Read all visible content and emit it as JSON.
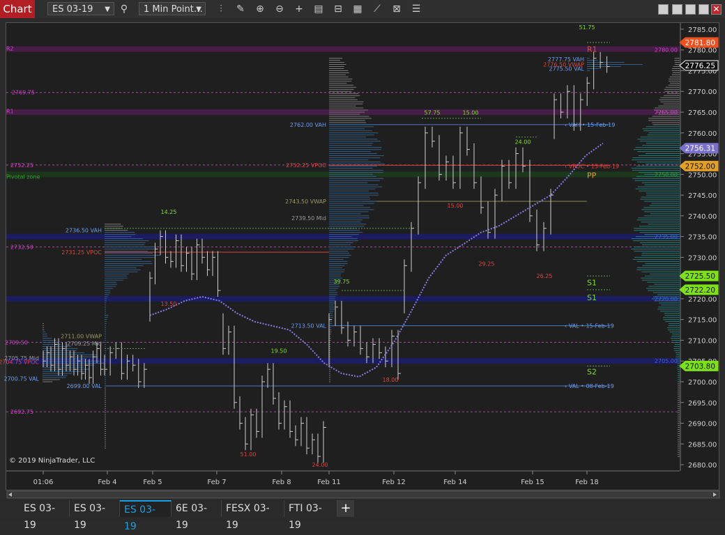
{
  "title_tab": "Chart",
  "toolbar": {
    "instrument": "ES 03-19",
    "interval": "1 Min Point…"
  },
  "colors": {
    "bg": "#1f1f1f",
    "accent": "#b11e23",
    "vwap": "#8a7fe6",
    "poc": "#e2423f",
    "vah": "#6a9ef2",
    "pivot": "#d040c8"
  },
  "copyright": "© 2019 NinjaTrader, LLC",
  "tabs": [
    "ES 03-19",
    "ES 03-19",
    "ES 03-19",
    "6E 03-19",
    "FESX 03-19",
    "FTI 03-19"
  ],
  "active_tab_index": 2,
  "chart_data": {
    "type": "line",
    "yaxis_labels": [
      "2785.00",
      "2780.00",
      "2775.00",
      "2770.00",
      "2765.00",
      "2760.00",
      "2755.00",
      "2750.00",
      "2745.00",
      "2740.00",
      "2735.00",
      "2730.00",
      "2725.00",
      "2720.00",
      "2715.00",
      "2710.00",
      "2705.00",
      "2700.00",
      "2695.00",
      "2690.00",
      "2685.00",
      "2680.00"
    ],
    "ylim": [
      2678.5,
      2786.5
    ],
    "xaxis_labels": [
      "01:06",
      "Feb 4",
      "Feb 5",
      "Feb 7",
      "Feb 8",
      "Feb 11",
      "Feb 12",
      "Feb 14",
      "Feb 15",
      "Feb 18"
    ],
    "price_tags": [
      {
        "value": "2781.80",
        "color": "#f0501e",
        "text": "#fff"
      },
      {
        "value": "2776.25",
        "color": "#111",
        "text": "#fff"
      },
      {
        "value": "2756.31",
        "color": "#7a70c8",
        "text": "#fff"
      },
      {
        "value": "2752.00",
        "color": "#e2a028",
        "text": "#111"
      },
      {
        "value": "2725.50",
        "color": "#7de01a",
        "text": "#111"
      },
      {
        "value": "2722.20",
        "color": "#7de01a",
        "text": "#111"
      },
      {
        "value": "2703.80",
        "color": "#7de01a",
        "text": "#111"
      }
    ],
    "pivot_labels": [
      {
        "text": "R2",
        "price": 2780.5,
        "color": "#d040c8"
      },
      {
        "text": "R1",
        "price": 2765.4,
        "color": "#d040c8"
      },
      {
        "text": "Pivotal zone",
        "price": 2749.6,
        "color": "#2fa02f"
      },
      {
        "text": "R1",
        "price": 2780.2,
        "color": "#f0501e"
      },
      {
        "text": "PP",
        "price": 2749.8,
        "color": "#e2a028"
      },
      {
        "text": "S1",
        "price": 2723.9,
        "color": "#7de01a"
      },
      {
        "text": "S1",
        "price": 2720.3,
        "color": "#7de01a"
      },
      {
        "text": "S2",
        "price": 2702.4,
        "color": "#7de01a"
      }
    ],
    "level_labels": [
      {
        "text": "2769.75",
        "price": 2769.75,
        "color": "#d040c8"
      },
      {
        "text": "2752.25",
        "price": 2752.25,
        "color": "#d040c8"
      },
      {
        "text": "2732.50",
        "price": 2732.5,
        "color": "#d040c8"
      },
      {
        "text": "2692.75",
        "price": 2692.75,
        "color": "#d040c8"
      },
      {
        "text": "2762.00 VAH",
        "price": 2762.0,
        "color": "#6a9ef2"
      },
      {
        "text": "2752.25 VPOC",
        "price": 2752.25,
        "color": "#e2423f"
      },
      {
        "text": "2743.50 VWAP",
        "price": 2743.5,
        "color": "#9a9a60"
      },
      {
        "text": "2739.50 Mid",
        "price": 2739.5,
        "color": "#9a9a9a"
      },
      {
        "text": "2736.50 VAH",
        "price": 2736.5,
        "color": "#6a9ef2"
      },
      {
        "text": "2731.25 VPOC",
        "price": 2731.25,
        "color": "#e2423f"
      },
      {
        "text": "2713.50 VAL",
        "price": 2713.5,
        "color": "#6a9ef2"
      },
      {
        "text": "2699.00 VAL",
        "price": 2699.0,
        "color": "#6a9ef2"
      },
      {
        "text": "2700.75 VAL",
        "price": 2700.75,
        "color": "#6a9ef2"
      },
      {
        "text": "2704.75 VPOC",
        "price": 2704.75,
        "color": "#e2423f"
      },
      {
        "text": "2709.50",
        "price": 2709.5,
        "color": "#d040c8"
      },
      {
        "text": "2711.00 VWAP",
        "price": 2711.0,
        "color": "#9a9a60"
      },
      {
        "text": "2709.25 Mid",
        "price": 2709.25,
        "color": "#9a9a9a"
      },
      {
        "text": "2705.75 Mid",
        "price": 2705.75,
        "color": "#9a9a9a"
      },
      {
        "text": "2777.75 VAH",
        "price": 2777.75,
        "color": "#6a9ef2"
      },
      {
        "text": "2776.50 VWAP",
        "price": 2776.5,
        "color": "#e2423f"
      },
      {
        "text": "2775.50 VAL",
        "price": 2775.5,
        "color": "#6a9ef2"
      },
      {
        "text": "2780.00",
        "price": 2780.0,
        "color": "#d040c8"
      },
      {
        "text": "2765.00",
        "price": 2765.0,
        "color": "#d040c8"
      },
      {
        "text": "2750.00",
        "price": 2750.0,
        "color": "#2fa02f"
      },
      {
        "text": "2735.00",
        "price": 2735.0,
        "color": "#4060e0"
      },
      {
        "text": "2720.00",
        "price": 2720.0,
        "color": "#4060e0"
      },
      {
        "text": "2705.00",
        "price": 2705.0,
        "color": "#4060e0"
      }
    ],
    "right_annotations": [
      {
        "text": "VAH • 15-Feb-19",
        "price": 2762.0,
        "color": "#6a9ef2"
      },
      {
        "text": "VPOC • 15-Feb-19",
        "price": 2752.0,
        "color": "#e2423f"
      },
      {
        "text": "VAL • 15-Feb-19",
        "price": 2713.5,
        "color": "#6a9ef2"
      },
      {
        "text": "VAL • 08-Feb-19",
        "price": 2699.0,
        "color": "#6a9ef2"
      }
    ],
    "swing_labels": [
      {
        "text": "14.25",
        "price": 2740.5,
        "day": "Feb 5",
        "color": "#7de01a"
      },
      {
        "text": "13.50",
        "price": 2718.3,
        "day": "Feb 5",
        "color": "#e2423f"
      },
      {
        "text": "19.50",
        "price": 2707.0,
        "day": "Feb 8",
        "color": "#7de01a"
      },
      {
        "text": "51.00",
        "price": 2682.0,
        "day": "Feb 7",
        "color": "#e2423f"
      },
      {
        "text": "24.00",
        "price": 2679.5,
        "day": "Feb 8",
        "color": "#e2423f"
      },
      {
        "text": "39.75",
        "price": 2723.7,
        "day": "Feb 11",
        "color": "#7de01a"
      },
      {
        "text": "18.00",
        "price": 2700.0,
        "day": "Feb 12",
        "color": "#e2423f"
      },
      {
        "text": "57.75",
        "price": 2764.4,
        "day": "Feb 12",
        "color": "#7de01a"
      },
      {
        "text": "15.00",
        "price": 2764.4,
        "day": "Feb 14",
        "color": "#7de01a"
      },
      {
        "text": "15.00",
        "price": 2742.0,
        "day": "Feb 14",
        "color": "#e2423f"
      },
      {
        "text": "29.25",
        "price": 2728.0,
        "day": "Feb 14",
        "color": "#e2423f"
      },
      {
        "text": "24.00",
        "price": 2757.4,
        "day": "Feb 15",
        "color": "#7de01a"
      },
      {
        "text": "26.25",
        "price": 2725.0,
        "day": "Feb 15",
        "color": "#e2423f"
      },
      {
        "text": "51.75",
        "price": 2785.0,
        "day": "Feb 18",
        "color": "#7de01a"
      }
    ],
    "vwap_series": [
      2716,
      2717.5,
      2719.5,
      2720.5,
      2719.5,
      2716.5,
      2714.5,
      2713.5,
      2712.5,
      2709,
      2704.5,
      2702.0,
      2701.2,
      2703.5,
      2709.5,
      2717,
      2725,
      2730.5,
      2733.2,
      2736,
      2737.5,
      2740,
      2742.5,
      2745,
      2749.5,
      2754.5,
      2757.5
    ]
  }
}
